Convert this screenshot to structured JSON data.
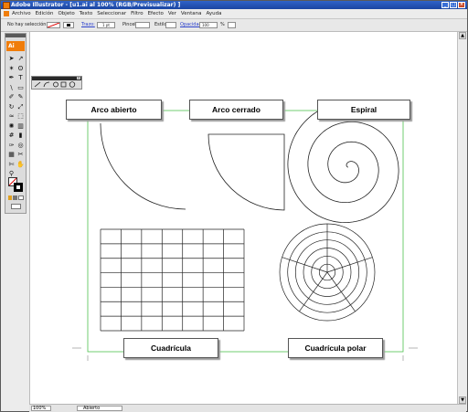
{
  "window": {
    "title": "Adobe Illustrator - [u1.ai al 100% (RGB/Previsualizar) ]"
  },
  "menu": {
    "items": [
      "Archivo",
      "Edición",
      "Objeto",
      "Texto",
      "Seleccionar",
      "Filtro",
      "Efecto",
      "Ver",
      "Ventana",
      "Ayuda"
    ]
  },
  "control": {
    "selection": "No hay selección",
    "stroke_label": "Trazo:",
    "stroke_value": "1 pt",
    "brush_label": "Pincel:",
    "style_label": "Estilo:",
    "opacity_label": "Opacidad:",
    "opacity_value": "100",
    "percent": "%"
  },
  "tools": {
    "logo": "Ai",
    "icons": [
      "selection-tool-icon",
      "direct-selection-tool-icon",
      "magic-wand-tool-icon",
      "lasso-tool-icon",
      "pen-tool-icon",
      "type-tool-icon",
      "line-tool-icon",
      "rectangle-tool-icon",
      "paintbrush-tool-icon",
      "pencil-tool-icon",
      "rotate-tool-icon",
      "scale-tool-icon",
      "warp-tool-icon",
      "free-transform-tool-icon",
      "symbol-sprayer-tool-icon",
      "graph-tool-icon",
      "mesh-tool-icon",
      "gradient-tool-icon",
      "eyedropper-tool-icon",
      "blend-tool-icon",
      "live-paint-tool-icon",
      "slice-tool-icon",
      "scissors-tool-icon",
      "hand-tool-icon",
      "zoom-tool-icon"
    ]
  },
  "artwork": {
    "labels": {
      "open_arc": "Arco abierto",
      "closed_arc": "Arco cerrado",
      "spiral": "Espiral",
      "grid": "Cuadrícula",
      "polar_grid": "Cuadrícula polar"
    }
  },
  "status": {
    "zoom": "100%",
    "tool": "Abierto"
  },
  "colors": {
    "titlebar": "#2357bd",
    "accent": "#f07d0a",
    "artboard_guide": "#4ec24e"
  }
}
